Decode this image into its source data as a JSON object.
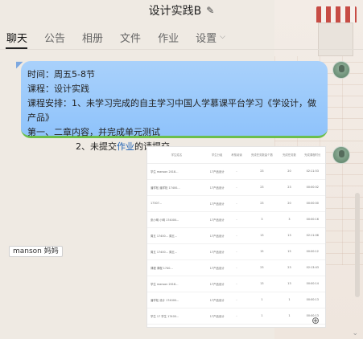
{
  "header": {
    "title": "设计实践B",
    "edit_icon": "pencil-icon"
  },
  "tabs": [
    {
      "label": "聊天",
      "active": true
    },
    {
      "label": "公告"
    },
    {
      "label": "相册"
    },
    {
      "label": "文件"
    },
    {
      "label": "作业"
    },
    {
      "label": "设置",
      "has_dropdown": true
    }
  ],
  "message": {
    "lines": [
      "时间：周五5-8节",
      "课程：设计实践",
      "课程安排：1、未学习完成的自主学习中国人学慕课平台学习《学设计，做产品》",
      "第一、二章内容，并完成单元测试",
      "2、未提交",
      "作业",
      "的请提交"
    ]
  },
  "sender_name_tag": "manson 妈妈",
  "screenshot_table": {
    "headers": [
      "学生姓名",
      "学生分组",
      "考核阅读",
      "完成任务数量个数",
      "完成任务数",
      "完成课程时长"
    ],
    "rows": [
      [
        "学生 manson 2018…",
        "17产品设计",
        "-",
        "23",
        "20",
        "02:11:53"
      ],
      [
        "潘学松 潘学松 17400…",
        "17产品设计",
        "-",
        "23",
        "23",
        "00:00:02"
      ],
      [
        "17307…",
        "17产品设计",
        "-",
        "23",
        "20",
        "00:00:00"
      ],
      [
        "张小明 小明 174000…",
        "17产品设计",
        "-",
        "3",
        "3",
        "00:00:16"
      ],
      [
        "周五 17400… 周五…",
        "17产品设计",
        "-",
        "13",
        "13",
        "02:11:06"
      ],
      [
        "周五 17400… 周五…",
        "17产品设计",
        "-",
        "15",
        "15",
        "00:00:12"
      ],
      [
        "课程 课程 1740…",
        "17产品设计",
        "-",
        "23",
        "23",
        "02:13:43"
      ],
      [
        "学生 manson 2018…",
        "17产品设计",
        "-",
        "13",
        "13",
        "00:00:14"
      ],
      [
        "潘学松 设计 174000…",
        "17产品设计",
        "-",
        "1",
        "1",
        "00:00:13"
      ],
      [
        "学生 17 学生 17400…",
        "17产品设计",
        "-",
        "1",
        "1",
        "00:00:13"
      ],
      [
        "17产品设计 学生 174000…",
        "17产品设计",
        "-",
        "1",
        "1",
        "00:00:14"
      ]
    ]
  },
  "colors": {
    "bubble": "#a9d1fb",
    "bubble_bottom": "#6bbf4c",
    "tab_active": "#111111"
  }
}
